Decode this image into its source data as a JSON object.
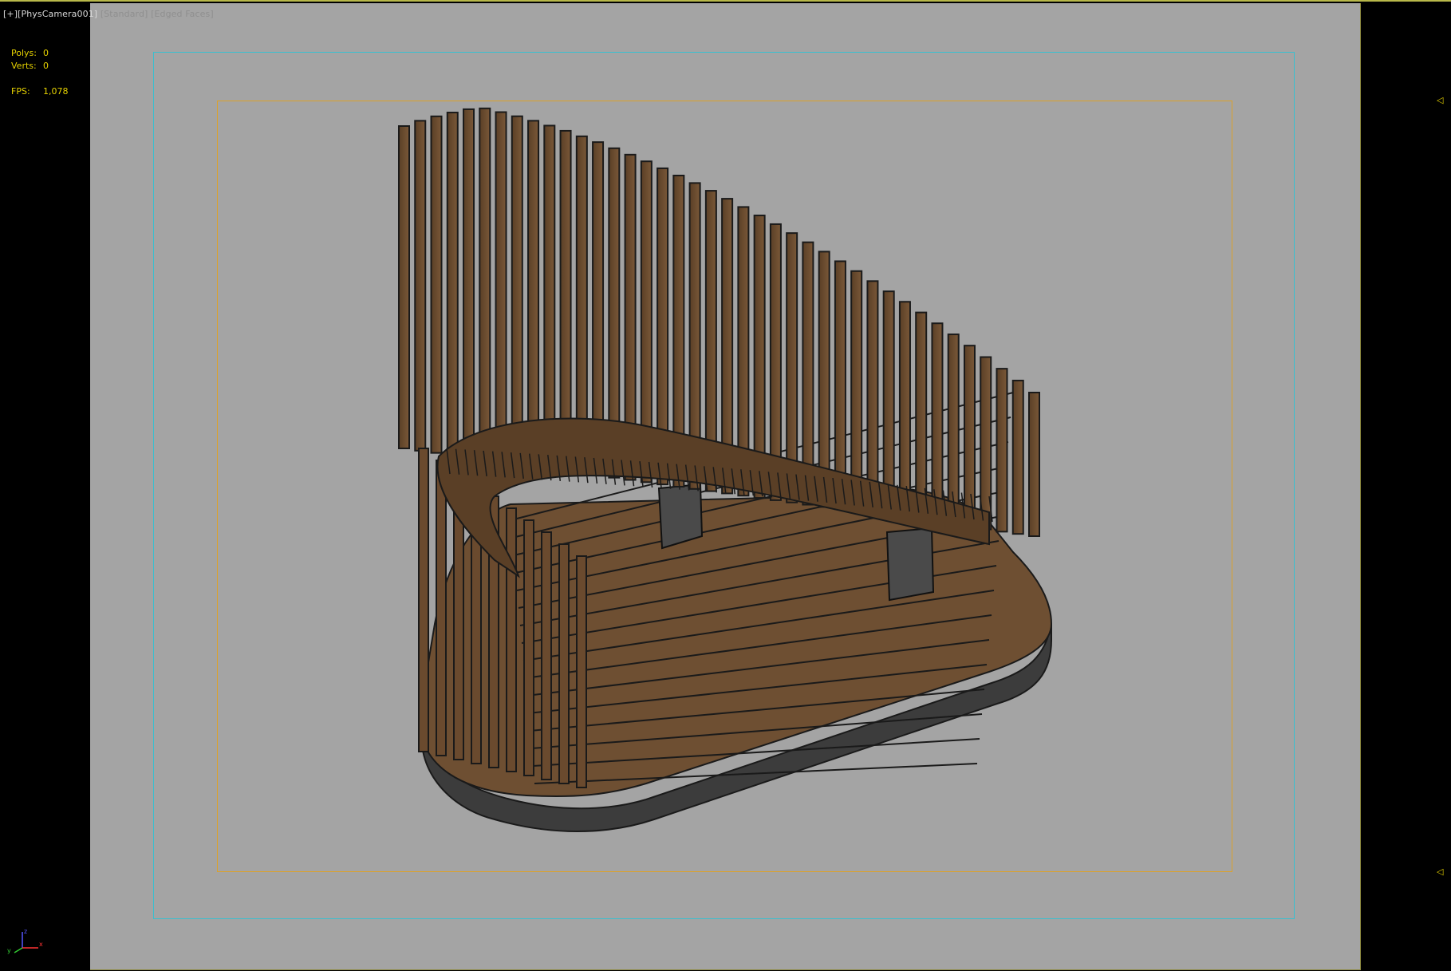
{
  "viewport": {
    "label": {
      "plus": "[+]",
      "camera": "[PhysCamera001]",
      "shading": "[Standard]",
      "mode": "[Edged Faces]"
    },
    "stats": {
      "polys_label": "Polys:",
      "polys_value": "0",
      "verts_label": "Verts:",
      "verts_value": "0",
      "fps_label": "FPS:",
      "fps_value": "1,078"
    },
    "markers": [
      "◁",
      "◁"
    ],
    "triad": {
      "x": "x",
      "y": "y",
      "z": "z"
    }
  },
  "colors": {
    "background_gray": "#a4a4a4",
    "wood": "#6e4f32",
    "base": "#3c3c3c",
    "safe_frame_outer": "#39bfcf",
    "safe_frame_inner": "#dba22b",
    "stats_text": "#e6d200"
  },
  "scene": {
    "object": "wooden slatted lounge chair model"
  }
}
